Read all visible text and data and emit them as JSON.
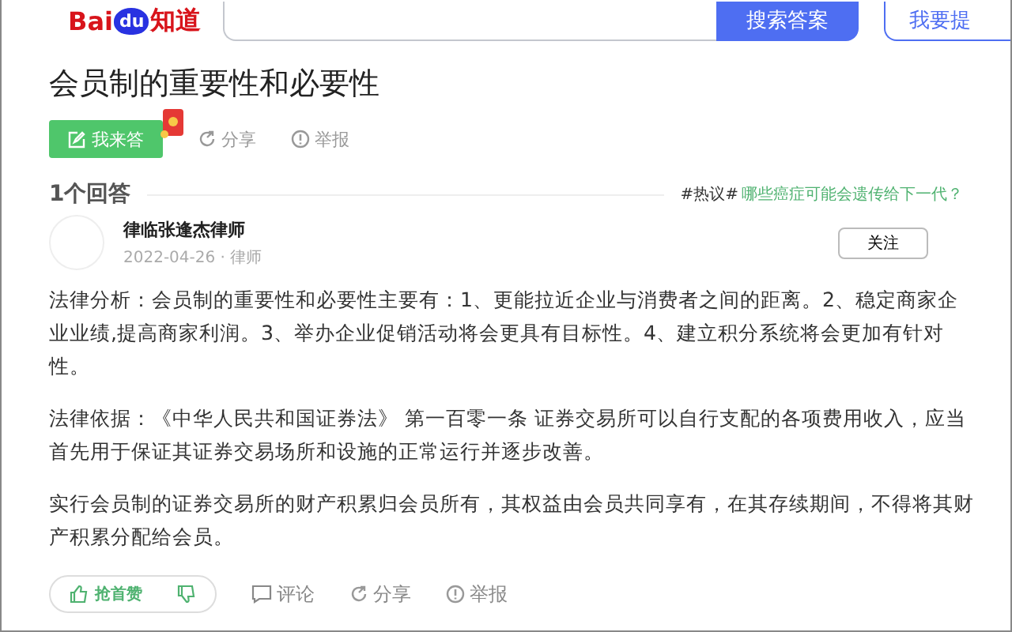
{
  "header": {
    "logo": {
      "left": "Bai",
      "middle": "du",
      "right": "知道"
    },
    "search_button": "搜索答案",
    "ask_button": "我要提"
  },
  "question": {
    "title": "会员制的重要性和必要性",
    "answer_button": "我来答",
    "share": "分享",
    "report": "举报"
  },
  "answers_header": {
    "count": "1个回答",
    "hot_tag": "#热议#",
    "hot_link": "哪些癌症可能会遗传给下一代？"
  },
  "answer": {
    "author": "律临张逢杰律师",
    "meta": "2022-04-26 · 律师",
    "follow_button": "关注",
    "paragraphs": [
      "法律分析：会员制的重要性和必要性主要有：1、更能拉近企业与消费者之间的距离。2、稳定商家企业业绩,提高商家利润。3、举办企业促销活动将会更具有目标性。4、建立积分系统将会更加有针对性。",
      "法律依据：《中华人民共和国证券法》 第一百零一条 证券交易所可以自行支配的各项费用收入，应当首先用于保证其证券交易场所和设施的正常运行并逐步改善。",
      "实行会员制的证券交易所的财产积累归会员所有，其权益由会员共同享有，在其存续期间，不得将其财产积累分配给会员。"
    ],
    "like_button": "抢首赞",
    "comment": "评论",
    "share": "分享",
    "report": "举报"
  }
}
